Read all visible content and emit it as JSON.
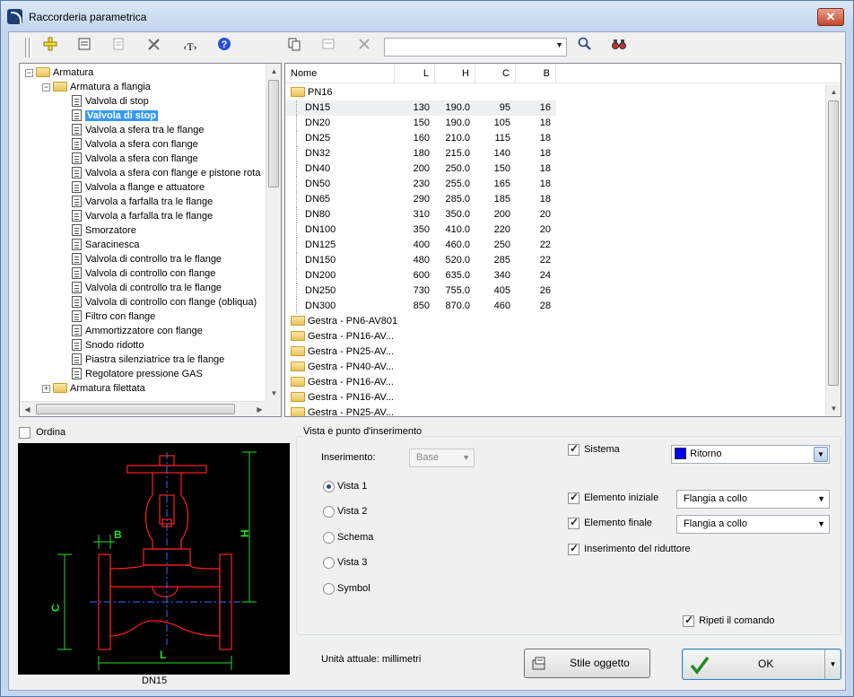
{
  "window": {
    "title": "Raccorderia parametrica"
  },
  "toolbar": {
    "search_value": ""
  },
  "tree": {
    "items": [
      {
        "label": "Armatura",
        "level": 0,
        "type": "folder",
        "expander": "−"
      },
      {
        "label": "Armatura a flangia",
        "level": 1,
        "type": "folder",
        "expander": "−"
      },
      {
        "label": "Valvola di stop",
        "level": 2,
        "type": "doc"
      },
      {
        "label": "Valvola di stop",
        "level": 2,
        "type": "doc",
        "selected": true
      },
      {
        "label": "Valvola a sfera tra le flange",
        "level": 2,
        "type": "doc"
      },
      {
        "label": "Valvola a sfera con flange",
        "level": 2,
        "type": "doc"
      },
      {
        "label": "Valvola a sfera con flange",
        "level": 2,
        "type": "doc"
      },
      {
        "label": "Valvola a sfera con flange e pistone rota",
        "level": 2,
        "type": "doc"
      },
      {
        "label": "Valvola a flange e attuatore",
        "level": 2,
        "type": "doc"
      },
      {
        "label": "Varvola a farfalla tra le flange",
        "level": 2,
        "type": "doc"
      },
      {
        "label": "Varvola a farfalla tra le flange",
        "level": 2,
        "type": "doc"
      },
      {
        "label": "Smorzatore",
        "level": 2,
        "type": "doc"
      },
      {
        "label": "Saracinesca",
        "level": 2,
        "type": "doc"
      },
      {
        "label": "Valvola di controllo tra le flange",
        "level": 2,
        "type": "doc"
      },
      {
        "label": "Valvola di controllo con flange",
        "level": 2,
        "type": "doc"
      },
      {
        "label": "Valvola di controllo tra le flange",
        "level": 2,
        "type": "doc"
      },
      {
        "label": "Valvola di controllo con flange (obliqua)",
        "level": 2,
        "type": "doc"
      },
      {
        "label": "Filtro con flange",
        "level": 2,
        "type": "doc"
      },
      {
        "label": "Ammortizzatore con flange",
        "level": 2,
        "type": "doc"
      },
      {
        "label": "Snodo ridotto",
        "level": 2,
        "type": "doc"
      },
      {
        "label": "Piastra silenziatrice tra le flange",
        "level": 2,
        "type": "doc"
      },
      {
        "label": "Regolatore pressione GAS",
        "level": 2,
        "type": "doc"
      },
      {
        "label": "Armatura filettata",
        "level": 1,
        "type": "folder",
        "expander": "+"
      }
    ]
  },
  "grid": {
    "columns": [
      "Nome",
      "L",
      "H",
      "C",
      "B"
    ],
    "group": "PN16",
    "rows": [
      [
        "DN15",
        "130",
        "190.0",
        "95",
        "16"
      ],
      [
        "DN20",
        "150",
        "190.0",
        "105",
        "18"
      ],
      [
        "DN25",
        "160",
        "210.0",
        "115",
        "18"
      ],
      [
        "DN32",
        "180",
        "215.0",
        "140",
        "18"
      ],
      [
        "DN40",
        "200",
        "250.0",
        "150",
        "18"
      ],
      [
        "DN50",
        "230",
        "255.0",
        "165",
        "18"
      ],
      [
        "DN65",
        "290",
        "285.0",
        "185",
        "18"
      ],
      [
        "DN80",
        "310",
        "350.0",
        "200",
        "20"
      ],
      [
        "DN100",
        "350",
        "410.0",
        "220",
        "20"
      ],
      [
        "DN125",
        "400",
        "460.0",
        "250",
        "22"
      ],
      [
        "DN150",
        "480",
        "520.0",
        "285",
        "22"
      ],
      [
        "DN200",
        "600",
        "635.0",
        "340",
        "24"
      ],
      [
        "DN250",
        "730",
        "755.0",
        "405",
        "26"
      ],
      [
        "DN300",
        "850",
        "870.0",
        "460",
        "28"
      ]
    ],
    "folders": [
      "Gestra - PN6-AV801",
      "Gestra - PN16-AV...",
      "Gestra - PN25-AV...",
      "Gestra - PN40-AV...",
      "Gestra - PN16-AV...",
      "Gestra - PN16-AV...",
      "Gestra - PN25-AV..."
    ]
  },
  "options": {
    "ordina_label": "Ordina",
    "group_title": "Vista e punto d'inserimento",
    "inserimento_label": "Inserimento:",
    "inserimento_value": "Base",
    "views": [
      "Vista 1",
      "Vista 2",
      "Schema",
      "Vista 3",
      "Symbol"
    ],
    "selected_view": "Vista 1",
    "sistema_label": "Sistema",
    "sistema_value": "Ritorno",
    "sistema_color": "#0000ff",
    "elemento_iniziale_label": "Elemento iniziale",
    "elemento_iniziale_value": "Flangia a collo",
    "elemento_finale_label": "Elemento finale",
    "elemento_finale_value": "Flangia a collo",
    "riduttore_label": "Inserimento del riduttore",
    "ripeti_label": "Ripeti il comando"
  },
  "preview": {
    "caption": "DN15",
    "dim_labels": {
      "b": "B",
      "h": "H",
      "c": "C",
      "l": "L"
    }
  },
  "footer": {
    "units_text": "Unità attuale: millimetri",
    "stile_label": "Stile oggetto",
    "ok_label": "OK"
  }
}
